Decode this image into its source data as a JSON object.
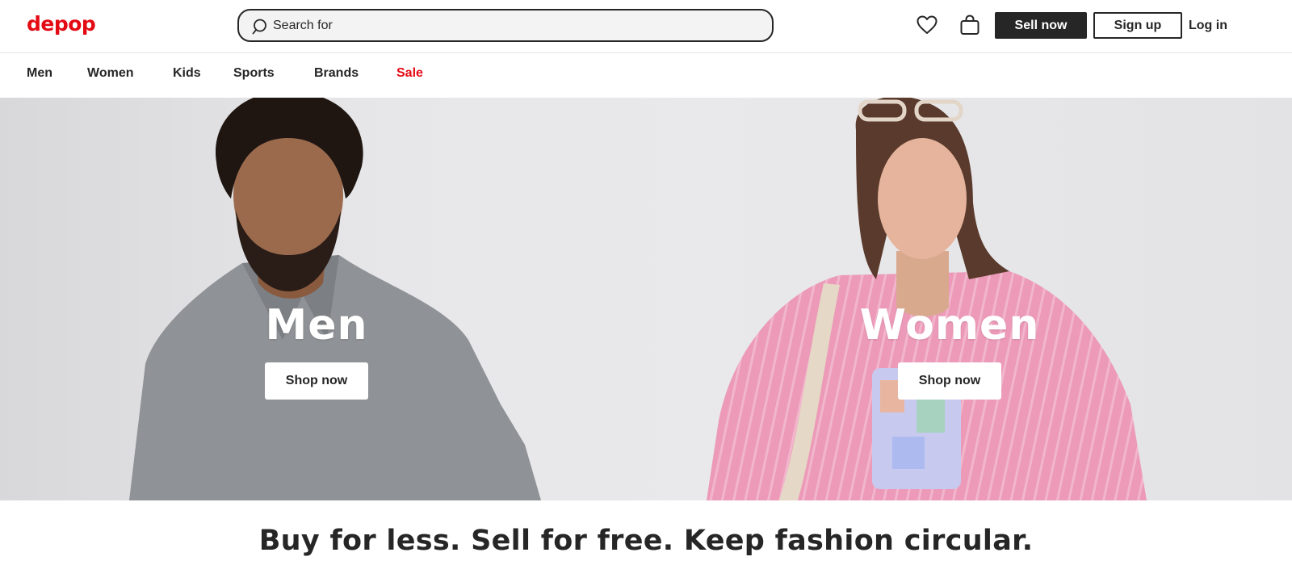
{
  "header": {
    "logo_text": "depop",
    "search_placeholder": "Search for",
    "icons": [
      "search-icon",
      "heart-icon",
      "shopping-bag-icon"
    ],
    "sell_label": "Sell now",
    "signup_label": "Sign up",
    "login_label": "Log in"
  },
  "nav": {
    "items": [
      {
        "label": "Men"
      },
      {
        "label": "Women"
      },
      {
        "label": "Kids"
      },
      {
        "label": "Sports"
      },
      {
        "label": "Brands"
      },
      {
        "label": "Sale"
      }
    ]
  },
  "hero": {
    "men": {
      "title": "Men",
      "button": "Shop now"
    },
    "women": {
      "title": "Women",
      "button": "Shop now"
    }
  },
  "tagline": "Buy for less. Sell for free. Keep fashion circular.",
  "colors": {
    "brand": "#e40a14",
    "ink": "#262626",
    "sale": "#e40a14"
  }
}
